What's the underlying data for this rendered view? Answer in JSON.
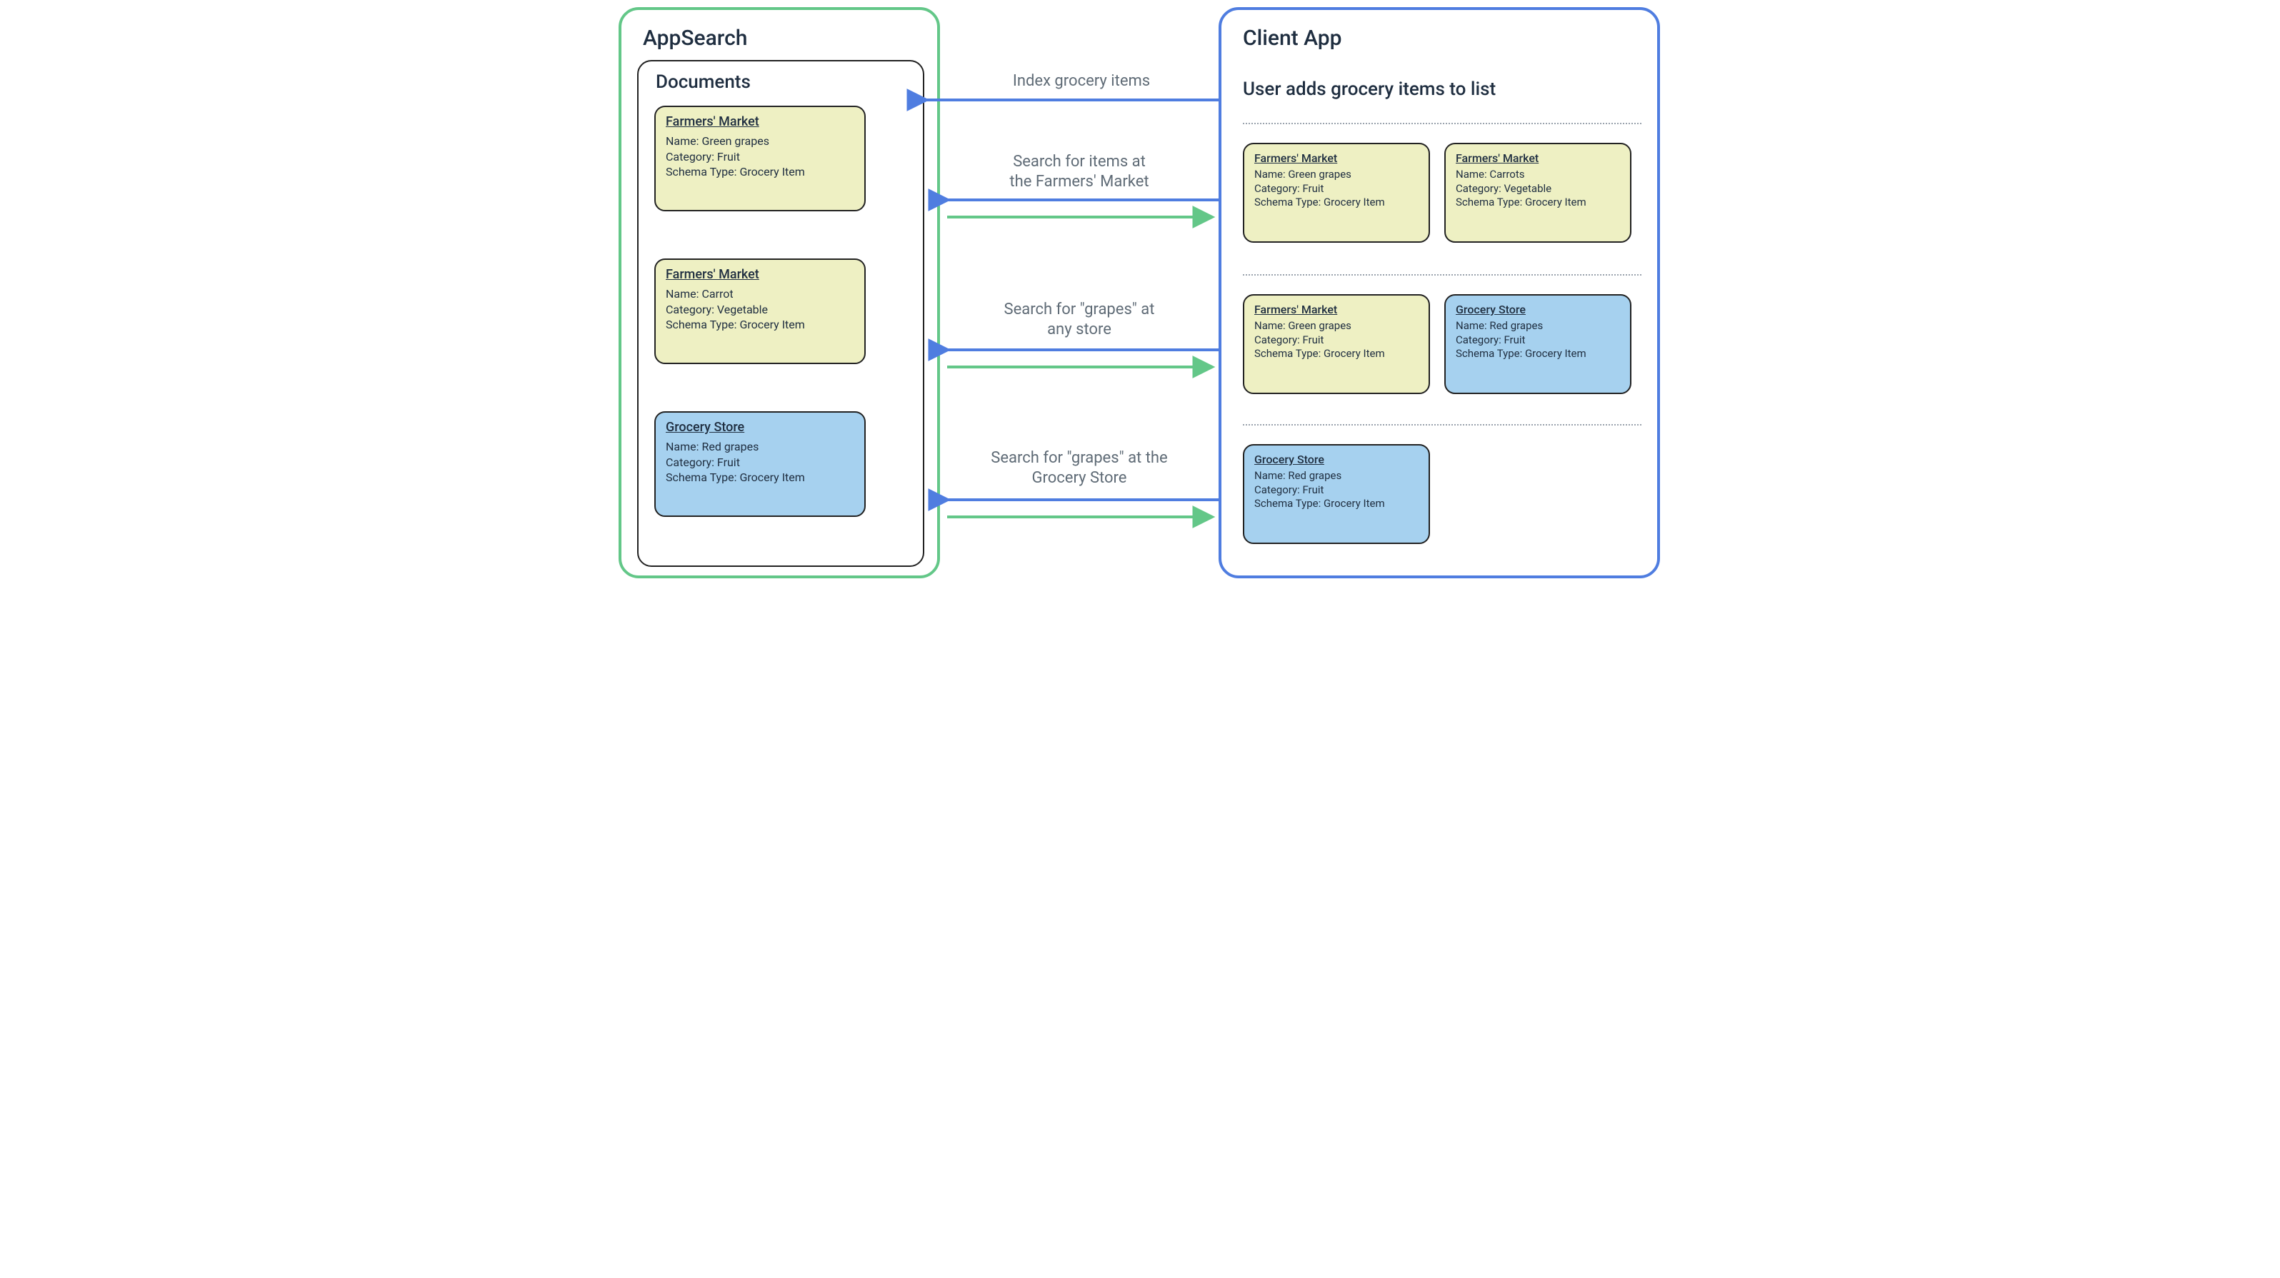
{
  "appsearch": {
    "title": "AppSearch",
    "documents_title": "Documents",
    "docs": [
      {
        "store": "Farmers' Market",
        "name_label": "Name: ",
        "name": "Green grapes",
        "category_label": "Category: ",
        "category": "Fruit",
        "schema_label": "Schema Type: ",
        "schema": "Grocery Item",
        "variant": "yellow"
      },
      {
        "store": "Farmers' Market",
        "name_label": "Name: ",
        "name": "Carrot",
        "category_label": "Category: ",
        "category": "Vegetable",
        "schema_label": "Schema Type: ",
        "schema": "Grocery Item",
        "variant": "yellow"
      },
      {
        "store": "Grocery Store",
        "name_label": "Name: ",
        "name": "Red grapes",
        "category_label": "Category: ",
        "category": "Fruit",
        "schema_label": "Schema Type: ",
        "schema": "Grocery Item",
        "variant": "bluebg"
      }
    ]
  },
  "client": {
    "title": "Client App",
    "subtitle": "User adds grocery items to list",
    "groups": [
      [
        {
          "store": "Farmers' Market",
          "name_label": "Name: ",
          "name": "Green grapes",
          "category_label": "Category: ",
          "category": "Fruit",
          "schema_label": "Schema Type: ",
          "schema": "Grocery Item",
          "variant": "yellow"
        },
        {
          "store": "Farmers' Market",
          "name_label": "Name: ",
          "name": "Carrots",
          "category_label": "Category: ",
          "category": "Vegetable",
          "schema_label": "Schema Type: ",
          "schema": "Grocery Item",
          "variant": "yellow"
        }
      ],
      [
        {
          "store": "Farmers' Market",
          "name_label": "Name: ",
          "name": "Green grapes",
          "category_label": "Category: ",
          "category": "Fruit",
          "schema_label": "Schema Type: ",
          "schema": "Grocery Item",
          "variant": "yellow"
        },
        {
          "store": "Grocery Store",
          "name_label": "Name: ",
          "name": "Red grapes",
          "category_label": "Category: ",
          "category": "Fruit",
          "schema_label": "Schema Type: ",
          "schema": "Grocery Item",
          "variant": "bluebg"
        }
      ],
      [
        {
          "store": "Grocery Store",
          "name_label": "Name: ",
          "name": "Red grapes",
          "category_label": "Category: ",
          "category": "Fruit",
          "schema_label": "Schema Type: ",
          "schema": "Grocery Item",
          "variant": "bluebg"
        }
      ]
    ]
  },
  "arrows": {
    "index": "Index grocery items",
    "search_farmers_l1": "Search for items at",
    "search_farmers_l2": "the Farmers' Market",
    "search_any_l1": "Search for \"grapes\" at",
    "search_any_l2": "any store",
    "search_grocery_l1": "Search for \"grapes\" at the",
    "search_grocery_l2": "Grocery Store"
  },
  "colors": {
    "green": "#63c788",
    "blue": "#4f7de0"
  }
}
